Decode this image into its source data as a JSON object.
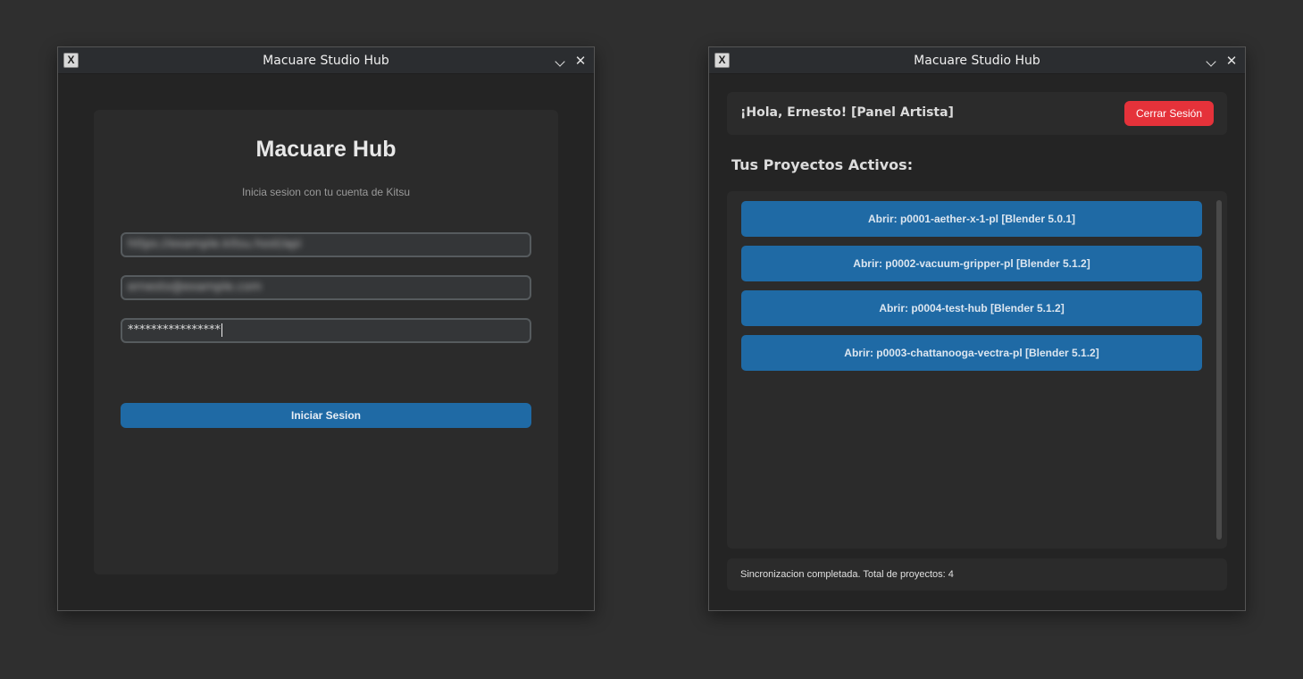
{
  "login_window": {
    "title": "Macuare Studio Hub",
    "app_icon": "x-icon",
    "card": {
      "title": "Macuare Hub",
      "subtitle": "Inicia sesion con tu cuenta de Kitsu",
      "user_field_value": "https://example.kitsu.host/api",
      "email_field_value": "ernesto@example.com",
      "password_value": "****************",
      "login_button": "Iniciar Sesion"
    }
  },
  "panel_window": {
    "title": "Macuare Studio Hub",
    "app_icon": "x-icon",
    "header": {
      "greeting": "¡Hola, Ernesto! [Panel Artista]",
      "logout_button": "Cerrar Sesión",
      "logout_color": "#e5323a"
    },
    "projects_heading": "Tus Proyectos Activos:",
    "projects": [
      {
        "label": "Abrir: p0001-aether-x-1-pl [Blender 5.0.1]"
      },
      {
        "label": "Abrir: p0002-vacuum-gripper-pl [Blender 5.1.2]"
      },
      {
        "label": "Abrir: p0004-test-hub [Blender 5.1.2]"
      },
      {
        "label": "Abrir: p0003-chattanooga-vectra-pl [Blender 5.1.2]"
      }
    ],
    "status": "Sincronizacion completada. Total de proyectos: 4"
  },
  "colors": {
    "accent": "#1f6aa5",
    "danger": "#e5323a",
    "window_bg": "#242424",
    "panel_bg": "#2b2b2b"
  }
}
